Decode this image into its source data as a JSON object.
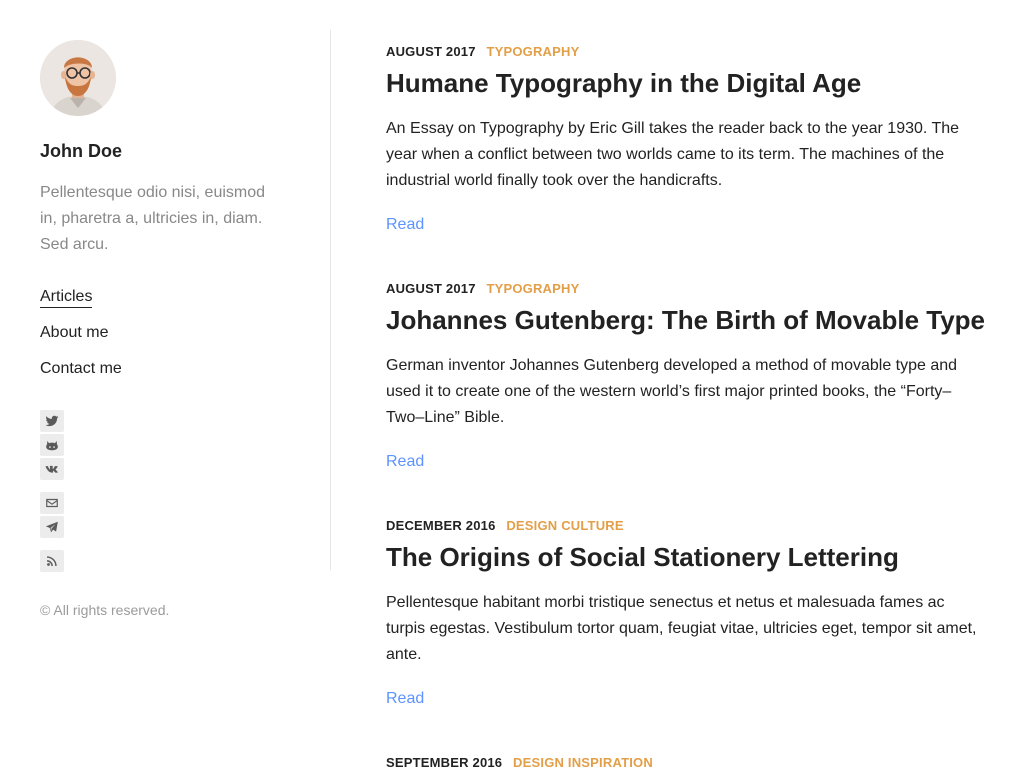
{
  "author": {
    "name": "John Doe",
    "bio": "Pellentesque odio nisi, euismod in, pharetra a, ultricies in, diam. Sed arcu."
  },
  "menu": [
    {
      "label": "Articles",
      "active": true
    },
    {
      "label": "About me",
      "active": false
    },
    {
      "label": "Contact me",
      "active": false
    }
  ],
  "social": [
    {
      "icon": "twitter-icon"
    },
    {
      "icon": "github-icon"
    },
    {
      "icon": "vk-icon"
    },
    {
      "icon": "email-icon"
    },
    {
      "icon": "telegram-icon"
    },
    {
      "icon": "rss-icon"
    }
  ],
  "copyright": "© All rights reserved.",
  "colors": {
    "category": "#e39f48",
    "link": "#5d93ff",
    "muted": "#888888"
  },
  "posts": [
    {
      "date": "AUGUST 2017",
      "category": "TYPOGRAPHY",
      "title": "Humane Typography in the Digital Age",
      "excerpt": "An Essay on Typography by Eric Gill takes the reader back to the year 1930. The year when a conflict between two worlds came to its term. The machines of the industrial world finally took over the handicrafts.",
      "read_label": "Read"
    },
    {
      "date": "AUGUST 2017",
      "category": "TYPOGRAPHY",
      "title": "Johannes Gutenberg: The Birth of Movable Type",
      "excerpt": "German inventor Johannes Gutenberg developed a method of movable type and used it to create one of the western world’s first major printed books, the “Forty–Two–Line” Bible.",
      "read_label": "Read"
    },
    {
      "date": "DECEMBER 2016",
      "category": "DESIGN CULTURE",
      "title": "The Origins of Social Stationery Lettering",
      "excerpt": "Pellentesque habitant morbi tristique senectus et netus et malesuada fames ac turpis egestas. Vestibulum tortor quam, feugiat vitae, ultricies eget, tempor sit amet, ante.",
      "read_label": "Read"
    },
    {
      "date": "SEPTEMBER 2016",
      "category": "DESIGN INSPIRATION"
    }
  ]
}
